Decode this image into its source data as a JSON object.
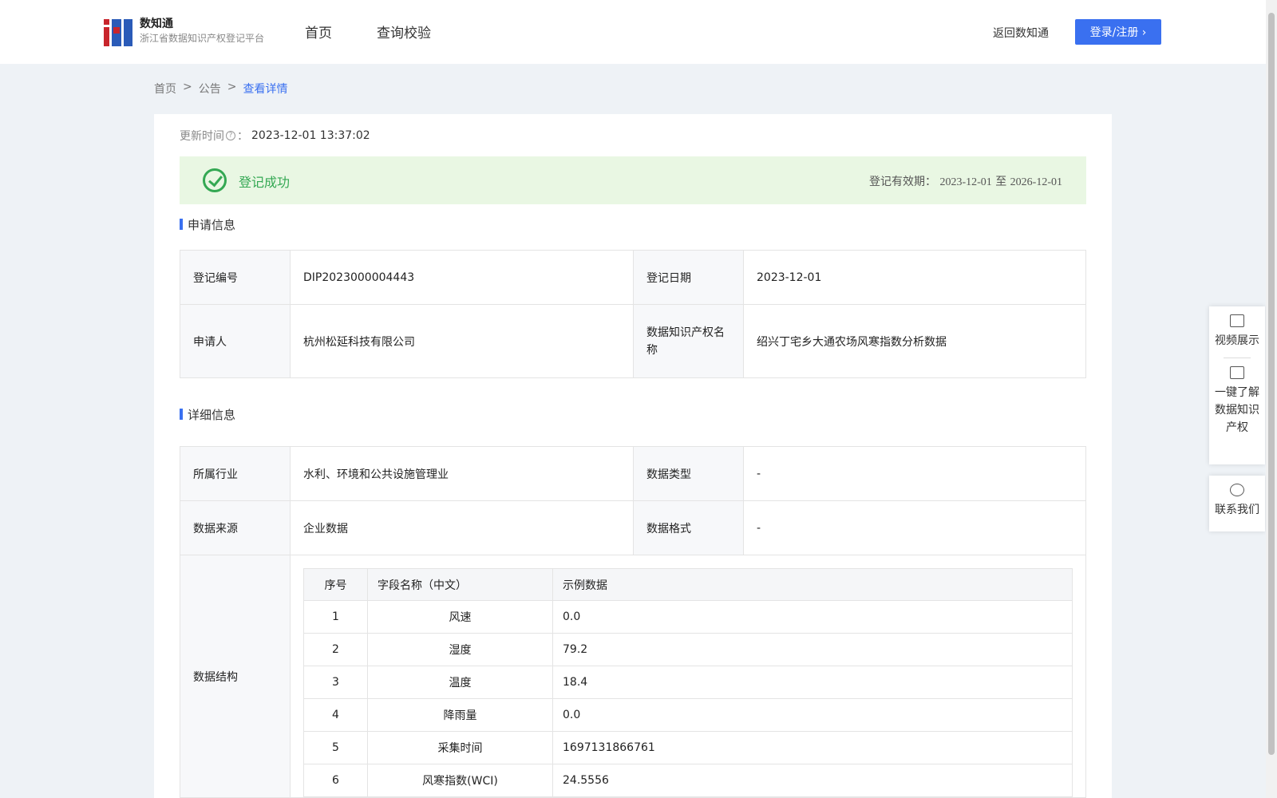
{
  "header": {
    "logo_title": "数知通",
    "logo_subtitle": "浙江省数据知识产权登记平台",
    "nav": [
      "首页",
      "查询校验"
    ],
    "back_link": "返回数知通",
    "login_button": "登录/注册 ›"
  },
  "breadcrumb": {
    "home": "首页",
    "sep": ">",
    "notice": "公告",
    "current": "查看详情"
  },
  "update": {
    "label": "更新时间",
    "suffix": "：",
    "value": "2023-12-01 13:37:02"
  },
  "status": {
    "text": "登记成功",
    "validity_label": "登记有效期：",
    "validity_start": "2023-12-01",
    "validity_to": "至",
    "validity_end": "2026-12-01"
  },
  "application": {
    "title": "申请信息",
    "reg_no_label": "登记编号",
    "reg_no": "DIP2023000004443",
    "reg_date_label": "登记日期",
    "reg_date": "2023-12-01",
    "applicant_label": "申请人",
    "applicant": "杭州松延科技有限公司",
    "ip_name_label": "数据知识产权名称",
    "ip_name": "绍兴丁宅乡大通农场风寒指数分析数据"
  },
  "details": {
    "title": "详细信息",
    "industry_label": "所属行业",
    "industry": "水利、环境和公共设施管理业",
    "data_type_label": "数据类型",
    "data_type": "-",
    "source_label": "数据来源",
    "source": "企业数据",
    "format_label": "数据格式",
    "format": "-",
    "structure_label": "数据结构",
    "structure_headers": [
      "序号",
      "字段名称（中文）",
      "示例数据"
    ],
    "structure_rows": [
      [
        "1",
        "风速",
        "0.0"
      ],
      [
        "2",
        "湿度",
        "79.2"
      ],
      [
        "3",
        "温度",
        "18.4"
      ],
      [
        "4",
        "降雨量",
        "0.0"
      ],
      [
        "5",
        "采集时间",
        "1697131866761"
      ],
      [
        "6",
        "风寒指数(WCI)",
        "24.5556"
      ]
    ]
  },
  "float_panel": {
    "video": "视频展示",
    "learn_1": "一键了解",
    "learn_2": "数据知识",
    "learn_3": "产权",
    "contact": "联系我们"
  }
}
